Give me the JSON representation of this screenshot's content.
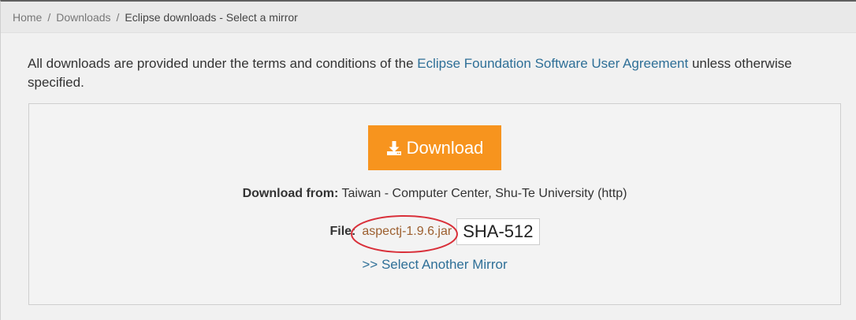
{
  "breadcrumb": {
    "items": [
      "Home",
      "Downloads"
    ],
    "separator": "/",
    "current": "Eclipse downloads - Select a mirror"
  },
  "intro": {
    "prefix": "All downloads are provided under the terms and conditions of the ",
    "link_text": "Eclipse Foundation Software User Agreement",
    "suffix": " unless otherwise specified."
  },
  "download": {
    "button_label": "Download",
    "button_icon": "download-icon",
    "from_label": "Download from:",
    "from_value": " Taiwan - Computer Center, Shu-Te University (http)",
    "file_label": "File:",
    "file_name": "aspectj-1.9.6.jar",
    "checksum_label": "SHA-512",
    "mirror_link": ">> Select Another Mirror"
  },
  "colors": {
    "button": "#f7941e",
    "link": "#2e6f97",
    "file_link": "#9c5f2f",
    "highlight_ellipse": "#d9303a"
  }
}
